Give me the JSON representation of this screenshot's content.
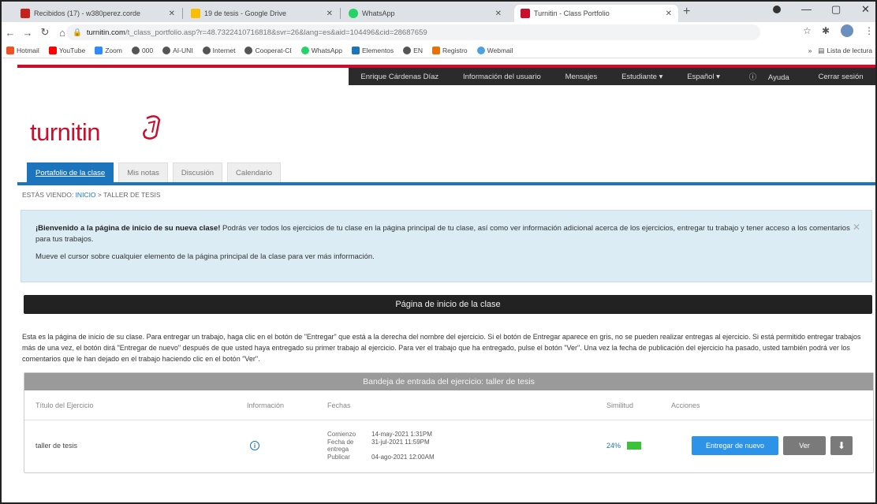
{
  "browser": {
    "tabs": [
      {
        "label": "Recibidos (17) - w380perez.corde",
        "color": "#c5221f"
      },
      {
        "label": "19 de tesis - Google Drive",
        "color": "#fbbc04"
      },
      {
        "label": "WhatsApp",
        "color": "#25d366"
      },
      {
        "label": "Turnitin - Class Portfolio",
        "color": "#c8102e"
      }
    ],
    "url_domain": "turnitin.com",
    "url_rest": "/t_class_portfolio.asp?r=48.7322410716818&svr=26&lang=es&aid=104496&cid=28687659",
    "bookmarks": [
      "Hotmail",
      "YouTube",
      "Zoom",
      "000",
      "AI-UNI",
      "Internet",
      "Cooperat-CI",
      "WhatsApp",
      "Elementos",
      "EN",
      "Registro",
      "Webmail"
    ],
    "reading_list": "Lista de lectura",
    "new_tab": "+",
    "window_controls": [
      "—",
      "▢",
      "✕"
    ]
  },
  "header": {
    "user": "Enrique Cárdenas Díaz",
    "menu": [
      "Información del usuario",
      "Mensajes",
      "Estudiante ▾",
      "Español ▾",
      "Ayuda",
      "Cerrar sesión"
    ]
  },
  "logo": "turnitin",
  "nav_tabs": [
    "Portafolio de la clase",
    "Mis notas",
    "Discusión",
    "Calendario"
  ],
  "breadcrumb": {
    "prefix": "ESTÁS VIENDO:",
    "link": "INICIO",
    "current": "> TALLER DE TESIS"
  },
  "welcome": {
    "title": "¡Bienvenido a la página de inicio de su nueva clase!",
    "body": " Podrás ver todos los ejercicios de tu clase en la página principal de tu clase, así como ver información adicional acerca de los ejercicios, entregar tu trabajo y tener acceso a los comentarios para tus trabajos.",
    "hint": "Mueve el cursor sobre cualquier elemento de la página principal de la clase para ver más información."
  },
  "home_title": "Página de inicio de la clase",
  "home_desc": "Esta es la página de inicio de su clase. Para entregar un trabajo, haga clic en el botón de \"Entregar\" que está a la derecha del nombre del ejercicio. Si el botón de Entregar aparece en gris, no se pueden realizar entregas al ejercicio. Si está permitido entregar trabajos más de una vez, el botón dirá \"Entregar de nuevo\" después de que usted haya entregado su primer trabajo al ejercicio. Para ver el trabajo que ha entregado, pulse el botón \"Ver\". Una vez la fecha de publicación del ejercicio ha pasado, usted también podrá ver los comentarios que le han dejado en el trabajo haciendo clic en el botón \"Ver\".",
  "inbox": {
    "title": "Bandeja de entrada del ejercicio: taller de tesis",
    "columns": [
      "Título del Ejercicio",
      "Información",
      "Fechas",
      "Similitud",
      "Acciones"
    ],
    "row": {
      "title": "taller de tesis",
      "dates": [
        {
          "label": "Comienzo",
          "value": "14-may-2021 1:31PM"
        },
        {
          "label": "Fecha de entrega",
          "value": "31-jul-2021 11:59PM"
        },
        {
          "label": "Publicar",
          "value": "04-ago-2021 12:00AM"
        }
      ],
      "similarity": "24%",
      "resubmit": "Entregar de nuevo",
      "view": "Ver"
    }
  }
}
